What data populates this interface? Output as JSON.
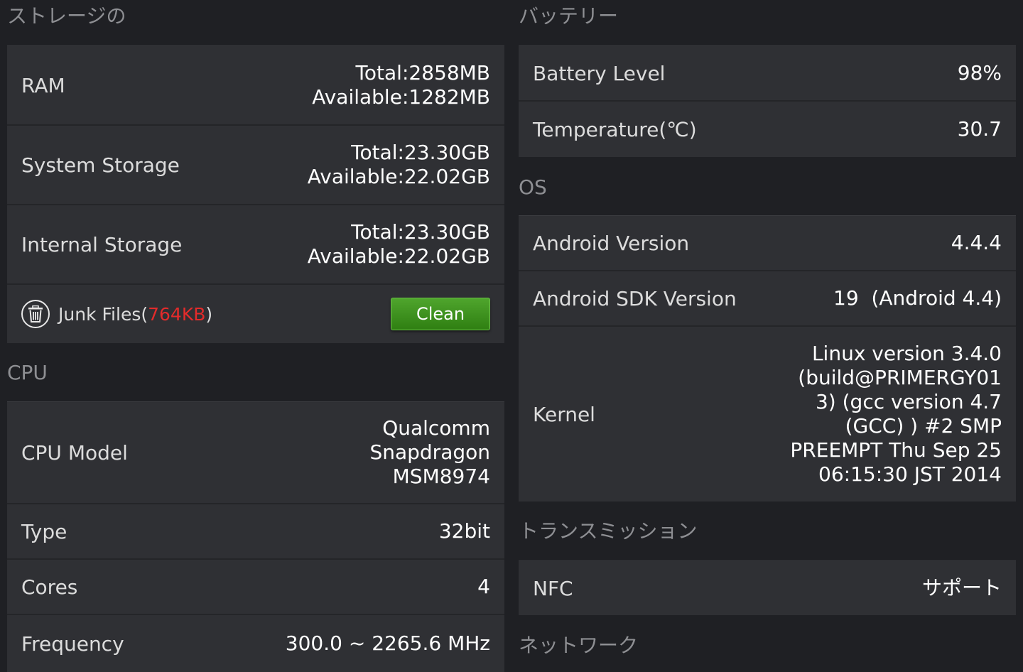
{
  "storage": {
    "title": "ストレージの",
    "ram": {
      "label": "RAM",
      "total": "Total:2858MB",
      "available": "Available:1282MB"
    },
    "system_storage": {
      "label": "System Storage",
      "total": "Total:23.30GB",
      "available": "Available:22.02GB"
    },
    "internal_storage": {
      "label": "Internal Storage",
      "total": "Total:23.30GB",
      "available": "Available:22.02GB"
    },
    "junk": {
      "prefix": "Junk Files(",
      "size": "764KB",
      "suffix": ")",
      "clean_label": "Clean"
    }
  },
  "cpu": {
    "title": "CPU",
    "model": {
      "label": "CPU Model",
      "lines": [
        "Qualcomm",
        "Snapdragon",
        "MSM8974"
      ]
    },
    "type": {
      "label": "Type",
      "value": "32bit"
    },
    "cores": {
      "label": "Cores",
      "value": "4"
    },
    "frequency": {
      "label": "Frequency",
      "value": "300.0 ~ 2265.6 MHz"
    }
  },
  "battery": {
    "title": "バッテリー",
    "level": {
      "label": "Battery Level",
      "value": "98%"
    },
    "temperature": {
      "label": "Temperature(℃)",
      "value": "30.7"
    }
  },
  "os": {
    "title": "OS",
    "android_version": {
      "label": "Android Version",
      "value": "4.4.4"
    },
    "sdk_version": {
      "label": "Android SDK Version",
      "value": "19  (Android 4.4)"
    },
    "kernel": {
      "label": "Kernel",
      "lines": [
        "Linux version 3.4.0",
        "(build@PRIMERGY01",
        "3) (gcc version 4.7",
        "(GCC) ) #2 SMP",
        "PREEMPT Thu Sep 25",
        "06:15:30 JST 2014"
      ]
    }
  },
  "transmission": {
    "title": "トランスミッション",
    "nfc": {
      "label": "NFC",
      "value": "サポート"
    }
  },
  "network": {
    "title": "ネットワーク"
  },
  "colors": {
    "background": "#1f2024",
    "card": "#2f3034",
    "section_title": "#8e8f93",
    "junk_size": "#e32b2b",
    "clean_button": "#3f9420"
  },
  "icons": {
    "junk": "trash-icon"
  }
}
